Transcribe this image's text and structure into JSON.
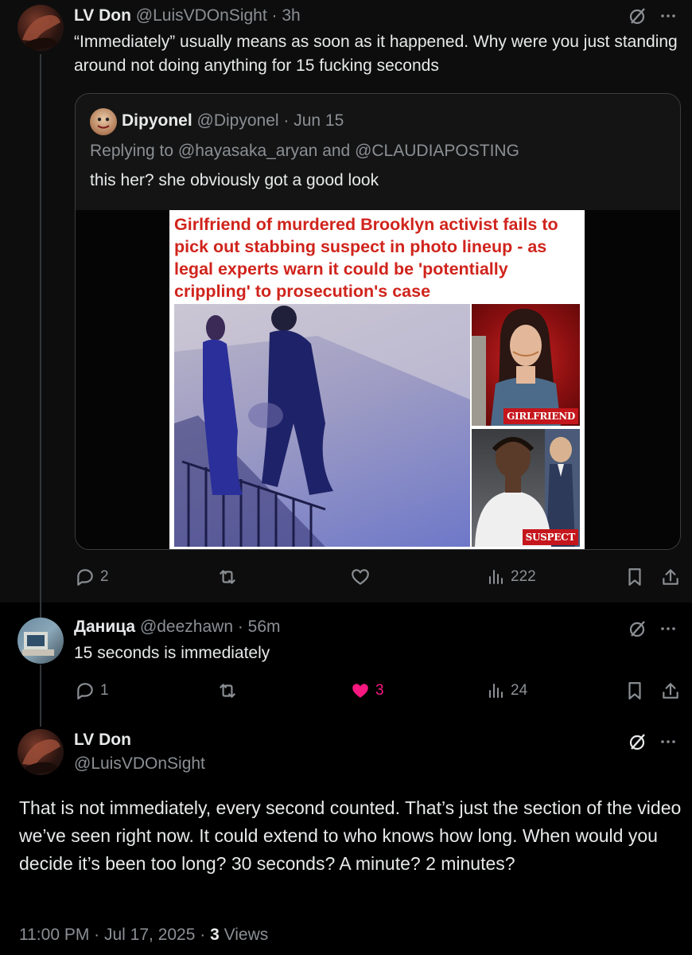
{
  "tweet1": {
    "name": "LV Don",
    "handle": "@LuisVDOnSight",
    "time": "3h",
    "text": "“Immediately” usually means as soon as it happened. Why were you just standing around not doing anything for 15 fucking seconds",
    "replies": "2",
    "views": "222"
  },
  "quote": {
    "name": "Dipyonel",
    "handle": "@Dipyonel",
    "date": "Jun 15",
    "replying_prefix": "Replying to",
    "replying_user1": "@hayasaka_aryan",
    "replying_and": "and",
    "replying_user2": "@CLAUDIAPOSTING",
    "text": "this her? she obviously got a good look",
    "article_headline": "Girlfriend of murdered Brooklyn activist fails to pick out stabbing suspect in photo lineup - as legal experts warn it could be 'potentially crippling' to prosecution's case",
    "tag_girlfriend": "GIRLFRIEND",
    "tag_suspect": "SUSPECT"
  },
  "tweet2": {
    "name": "Даница",
    "handle": "@deezhawn",
    "time": "56m",
    "text": "15 seconds is immediately",
    "replies": "1",
    "likes": "3",
    "views": "24"
  },
  "tweet3": {
    "name": "LV Don",
    "handle": "@LuisVDOnSight",
    "text": "That is not immediately, every second counted. That’s just the section of the video we’ve seen right now. It could extend to who knows how long. When would you decide it’s been too long? 30 seconds? A minute? 2 minutes?",
    "timestamp": "11:00 PM · Jul 17, 2025 ·",
    "views_count": "3",
    "views_label": "Views"
  },
  "colors": {
    "background": "#000000",
    "secondary_text": "#8b8f94",
    "like_pink": "#f91880",
    "headline_red": "#d0241c"
  },
  "icons": [
    "reply-icon",
    "retweet-icon",
    "like-icon",
    "views-icon",
    "bookmark-icon",
    "share-icon",
    "grok-icon",
    "more-icon"
  ]
}
